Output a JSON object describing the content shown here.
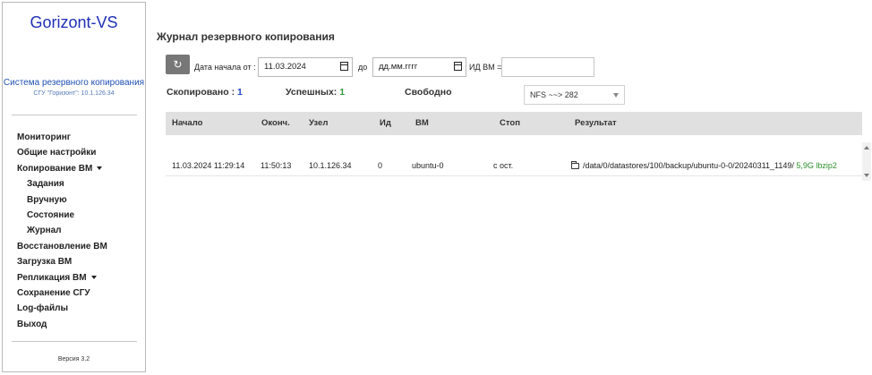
{
  "sidebar": {
    "logo": "Gorizont-VS",
    "subtitle": "Система резервного копирования",
    "subinfo": "СГУ \"Горизонт\": 10.1.126.34",
    "items": [
      {
        "label": "Мониторинг"
      },
      {
        "label": "Общие настройки"
      },
      {
        "label": "Копирование ВМ"
      },
      {
        "label": "Задания"
      },
      {
        "label": "Вручную"
      },
      {
        "label": "Состояние"
      },
      {
        "label": "Журнал"
      },
      {
        "label": "Восстановление ВМ"
      },
      {
        "label": "Загрузка ВМ"
      },
      {
        "label": "Репликация ВМ"
      },
      {
        "label": "Сохранение СГУ"
      },
      {
        "label": "Log-файлы"
      },
      {
        "label": "Выход"
      }
    ],
    "version": "Версия 3.2"
  },
  "main": {
    "title": "Журнал резервного копирования",
    "filter": {
      "refresh_icon": "refresh-icon",
      "start_label": "Дата начала от :",
      "start_value": "11.03.2024",
      "to_label": "до",
      "end_placeholder": "дд.мм.гггг",
      "vm_id_label": "ИД ВМ =",
      "vm_id_value": ""
    },
    "stats": {
      "copied_label": "Скопировано :",
      "copied_value": "1",
      "success_label": "Успешных:",
      "success_value": "1",
      "free_label": "Свободно"
    },
    "storage_select": {
      "selected": "NFS ~~> 282"
    },
    "table": {
      "headers": [
        "Начало",
        "Оконч.",
        "Узел",
        "Ид",
        "ВМ",
        "Стоп",
        "Результат"
      ],
      "rows": [
        {
          "start": "11.03.2024 11:29:14",
          "end": "11:50:13",
          "node": "10.1.126.34",
          "id": "0",
          "vm": "ubuntu-0",
          "stop": "с ост.",
          "result_path": "/data/0/datastores/100/backup/ubuntu-0-0/20240311_1149/",
          "result_size": "5,9G lbzip2"
        }
      ]
    }
  },
  "colors": {
    "logo": "#1f2fb6",
    "copied_value": "#1f47c6",
    "success_value": "#2f9a3a",
    "result_size": "#2c8f2c",
    "table_header_bg": "#e0e0e0"
  }
}
